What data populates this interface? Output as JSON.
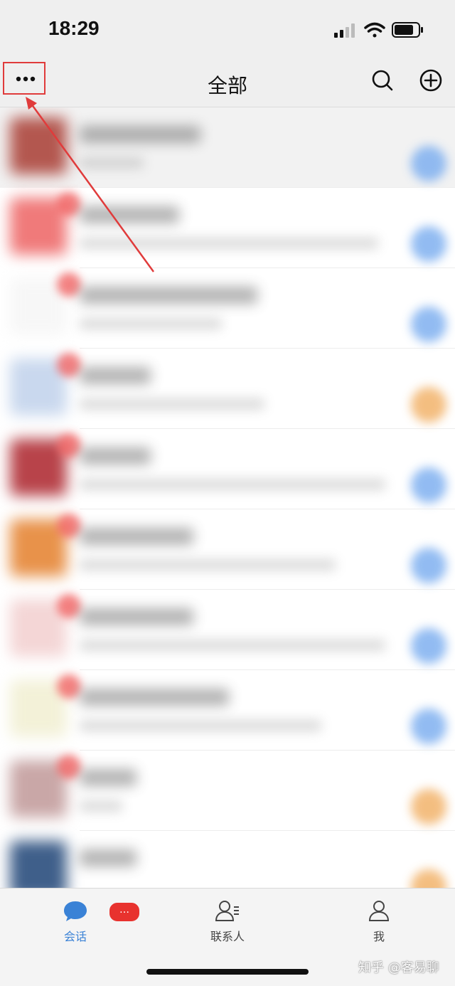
{
  "status_bar": {
    "time": "18:29"
  },
  "nav": {
    "title": "全部",
    "more_icon": "more-dots-icon",
    "search_icon": "search-icon",
    "add_icon": "add-circle-icon"
  },
  "annotation": {
    "color": "#e03b3b"
  },
  "conversation_list": {
    "blurred": true,
    "row_count": 10,
    "rows": [
      {
        "avatar_color": "#b3574f",
        "badge": false,
        "tag_color": "#7fb0f0",
        "highlight": true,
        "line1_w": 170,
        "line2_w": 90
      },
      {
        "avatar_color": "#f07a7a",
        "badge": true,
        "tag_color": "#7fb0f0",
        "highlight": false,
        "line1_w": 140,
        "line2_w": 420
      },
      {
        "avatar_color": "#f7f7f7",
        "badge": true,
        "tag_color": "#7fb0f0",
        "highlight": false,
        "line1_w": 250,
        "line2_w": 200
      },
      {
        "avatar_color": "#c9d8ee",
        "badge": true,
        "tag_color": "#f2b36b",
        "highlight": false,
        "line1_w": 100,
        "line2_w": 260
      },
      {
        "avatar_color": "#b8434a",
        "badge": true,
        "tag_color": "#7fb0f0",
        "highlight": false,
        "line1_w": 100,
        "line2_w": 430
      },
      {
        "avatar_color": "#e8924a",
        "badge": true,
        "tag_color": "#7fb0f0",
        "highlight": false,
        "line1_w": 160,
        "line2_w": 360
      },
      {
        "avatar_color": "#f4d6d6",
        "badge": true,
        "tag_color": "#7fb0f0",
        "highlight": false,
        "line1_w": 160,
        "line2_w": 430
      },
      {
        "avatar_color": "#f3f1d8",
        "badge": true,
        "tag_color": "#7fb0f0",
        "highlight": false,
        "line1_w": 210,
        "line2_w": 340
      },
      {
        "avatar_color": "#c9a7a7",
        "badge": true,
        "tag_color": "#f2b36b",
        "highlight": false,
        "line1_w": 80,
        "line2_w": 60
      },
      {
        "avatar_color": "#3f5f8a",
        "badge": false,
        "tag_color": "#f2b36b",
        "highlight": false,
        "line1_w": 80,
        "line2_w": 0
      }
    ]
  },
  "tab_bar": {
    "tabs": [
      {
        "label": "会话",
        "icon": "chat-bubble-icon",
        "active": true,
        "badge": "…"
      },
      {
        "label": "联系人",
        "icon": "contacts-icon",
        "active": false
      },
      {
        "label": "我",
        "icon": "person-icon",
        "active": false
      }
    ]
  },
  "watermark": "知乎 @客易聊"
}
